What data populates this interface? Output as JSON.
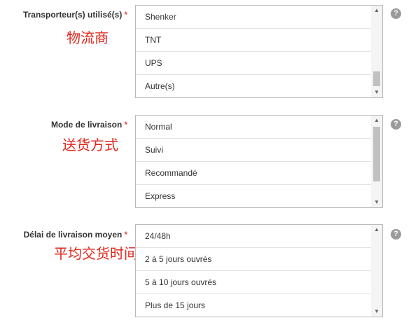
{
  "fields": [
    {
      "label": "Transporteur(s) utilisé(s)",
      "required_mark": "*",
      "annotation": "物流商",
      "options": [
        "Shenker",
        "TNT",
        "UPS",
        "Autre(s)"
      ],
      "scroll_position": 0.9,
      "help_icon": "?"
    },
    {
      "label": "Mode de livraison",
      "required_mark": "*",
      "annotation": "送货方式",
      "options": [
        "Normal",
        "Suivi",
        "Recommandé",
        "Express"
      ],
      "scroll_position": 0.1,
      "help_icon": "?"
    },
    {
      "label": "Délai de livraison moyen",
      "required_mark": "*",
      "annotation": "平均交货时间",
      "options": [
        "24/48h",
        "2 à 5 jours ouvrés",
        "5 à 10 jours ouvrés",
        "Plus de 15 jours"
      ],
      "scroll_position": 0.0,
      "help_icon": "?"
    }
  ],
  "colors": {
    "required": "#d9534f",
    "annotation": "#e0261b",
    "border": "#bbbbbb",
    "help_icon": "#9a9a9a"
  },
  "icons": {
    "scroll_up": "triangle-up-icon",
    "scroll_down": "triangle-down-icon",
    "help": "question-circle-icon"
  }
}
